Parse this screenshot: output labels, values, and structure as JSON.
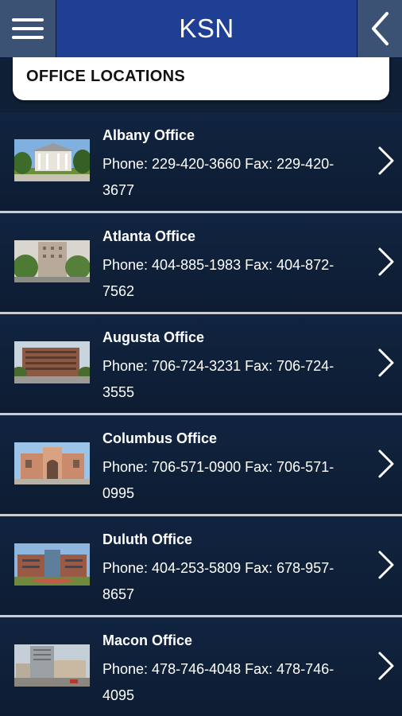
{
  "header": {
    "title": "KSN"
  },
  "section": {
    "title": "OFFICE LOCATIONS"
  },
  "offices": [
    {
      "name": "Albany Office",
      "contact": "Phone: 229-420-3660 Fax: 229-420-3677"
    },
    {
      "name": "Atlanta Office",
      "contact": "Phone: 404-885-1983 Fax: 404-872-7562"
    },
    {
      "name": "Augusta Office",
      "contact": "Phone: 706-724-3231 Fax: 706-724-3555"
    },
    {
      "name": "Columbus Office",
      "contact": "Phone: 706-571-0900 Fax: 706-571-0995"
    },
    {
      "name": "Duluth Office",
      "contact": "Phone: 404-253-5809 Fax: 678-957-8657"
    },
    {
      "name": "Macon Office",
      "contact": "Phone: 478-746-4048 Fax: 478-746-4095"
    }
  ],
  "icons": {
    "menu": "hamburger-menu-icon",
    "back": "chevron-left-icon",
    "row_arrow": "chevron-right-icon"
  },
  "colors": {
    "header_bg": "#1f3f94",
    "page_bg": "#0f1f36",
    "text": "#ffffff"
  }
}
